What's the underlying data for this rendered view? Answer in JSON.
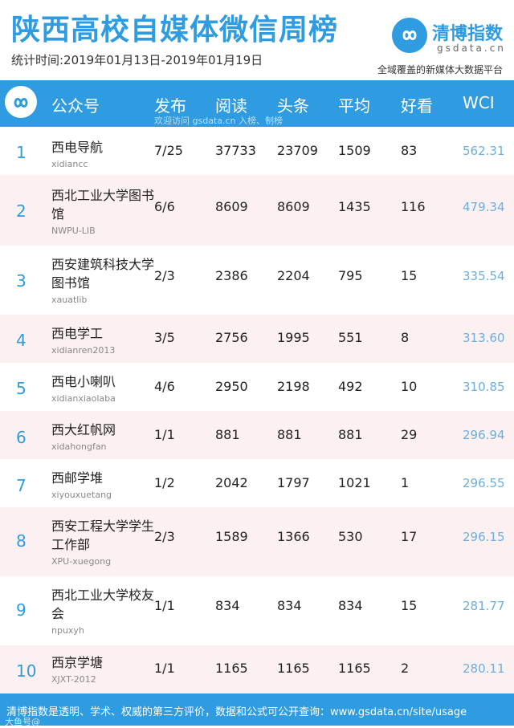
{
  "header": {
    "title": "陕西高校自媒体微信周榜",
    "period": "统计时间:2019年01月13日-2019年01月19日",
    "brand_name": "清博指数",
    "brand_domain": "gsdata.cn",
    "brand_slogan": "全域覆盖的新媒体大数据平台"
  },
  "table": {
    "columns": [
      "公众号",
      "发布",
      "阅读",
      "头条",
      "平均",
      "好看",
      "WCI"
    ],
    "watermark": "欢迎访问 gsdata.cn 入榜、制榜",
    "rows": [
      {
        "rank": "1",
        "name": "西电导航",
        "id": "xidiancc",
        "publish": "7/25",
        "read": "37733",
        "headline": "23709",
        "avg": "1509",
        "like": "83",
        "wci": "562.31"
      },
      {
        "rank": "2",
        "name": "西北工业大学图书馆",
        "id": "NWPU-LIB",
        "publish": "6/6",
        "read": "8609",
        "headline": "8609",
        "avg": "1435",
        "like": "116",
        "wci": "479.34"
      },
      {
        "rank": "3",
        "name": "西安建筑科技大学图书馆",
        "id": "xauatlib",
        "publish": "2/3",
        "read": "2386",
        "headline": "2204",
        "avg": "795",
        "like": "15",
        "wci": "335.54"
      },
      {
        "rank": "4",
        "name": "西电学工",
        "id": "xidianren2013",
        "publish": "3/5",
        "read": "2756",
        "headline": "1995",
        "avg": "551",
        "like": "8",
        "wci": "313.60"
      },
      {
        "rank": "5",
        "name": "西电小喇叭",
        "id": "xidianxiaolaba",
        "publish": "4/6",
        "read": "2950",
        "headline": "2198",
        "avg": "492",
        "like": "10",
        "wci": "310.85"
      },
      {
        "rank": "6",
        "name": "西大红帆网",
        "id": "xidahongfan",
        "publish": "1/1",
        "read": "881",
        "headline": "881",
        "avg": "881",
        "like": "29",
        "wci": "296.94"
      },
      {
        "rank": "7",
        "name": "西邮学堆",
        "id": "xiyouxuetang",
        "publish": "1/2",
        "read": "2042",
        "headline": "1797",
        "avg": "1021",
        "like": "1",
        "wci": "296.55"
      },
      {
        "rank": "8",
        "name": "西安工程大学学生工作部",
        "id": "XPU-xuegong",
        "publish": "2/3",
        "read": "1589",
        "headline": "1366",
        "avg": "530",
        "like": "17",
        "wci": "296.15"
      },
      {
        "rank": "9",
        "name": "西北工业大学校友会",
        "id": "npuxyh",
        "publish": "1/1",
        "read": "834",
        "headline": "834",
        "avg": "834",
        "like": "15",
        "wci": "281.77"
      },
      {
        "rank": "10",
        "name": "西京学塘",
        "id": "XJXT-2012",
        "publish": "1/1",
        "read": "1165",
        "headline": "1165",
        "avg": "1165",
        "like": "2",
        "wci": "280.11"
      }
    ]
  },
  "footer": {
    "text": "清博指数是透明、学术、权威的第三方评价，数据和公式可公开查询：www.gsdata.cn/site/usage",
    "mark": "大鱼号@"
  },
  "colors": {
    "accent": "#2f9be0",
    "alt_row": "#fdf0f0",
    "wci": "#6aaee2"
  }
}
